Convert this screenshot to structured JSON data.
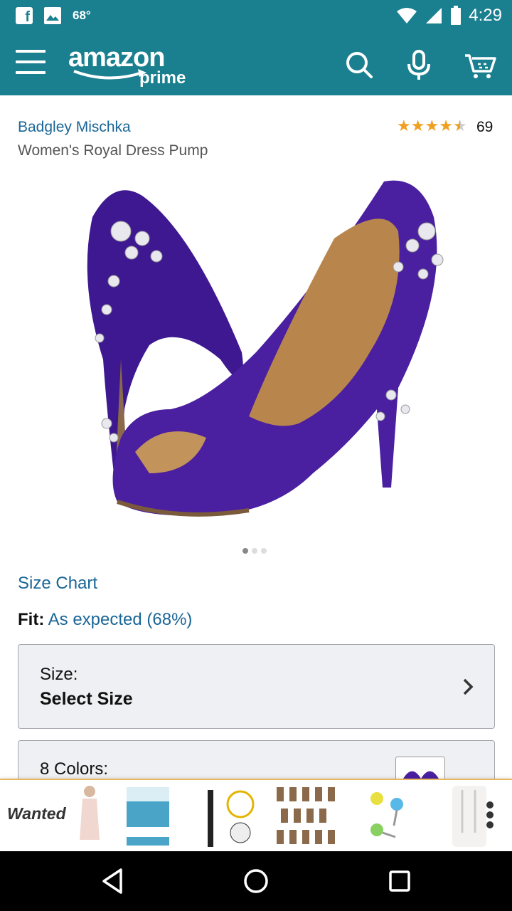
{
  "status_bar": {
    "temperature": "68°",
    "time": "4:29",
    "icons": [
      "facebook-icon",
      "image-icon",
      "wifi-icon",
      "signal-icon",
      "battery-icon"
    ]
  },
  "app_bar": {
    "logo_word": "amazon",
    "logo_sub": "prime",
    "color": "#1a7f8f",
    "icons": [
      "menu-icon",
      "search-icon",
      "microphone-icon",
      "cart-icon"
    ]
  },
  "product": {
    "brand": "Badgley Mischka",
    "title": "Women's Royal Dress Pump",
    "rating_stars": 4.5,
    "rating_count": "69",
    "image_page": 1,
    "image_count": 3,
    "size_chart": "Size Chart",
    "fit_label": "Fit:",
    "fit_value": "As expected (68%)",
    "size_label": "Size:",
    "size_value": "Select Size",
    "colors_label": "8 Colors:"
  },
  "ad_strip": {
    "label": "Wanted",
    "items": [
      "dress-model",
      "neutrogena-product",
      "cable-organizer",
      "essential-oils-set",
      "key-caps",
      "glass-straws"
    ]
  },
  "colors": {
    "teal": "#1a7f8f",
    "link_blue": "#1a6696",
    "star_gold": "#f0a020",
    "shoe_purple": "#4a1fa0"
  }
}
